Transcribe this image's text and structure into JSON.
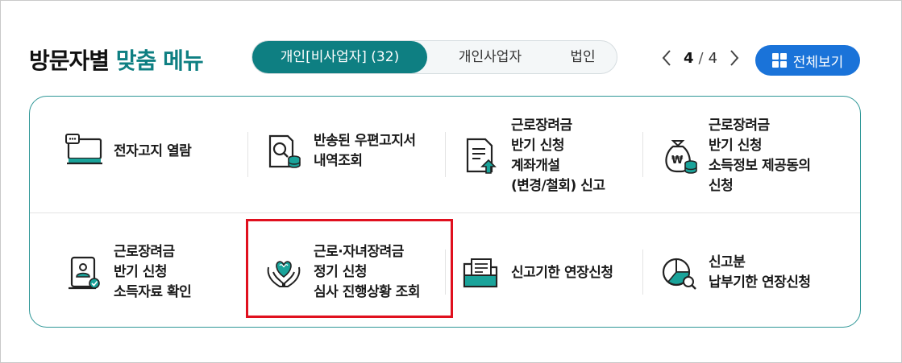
{
  "header": {
    "title_main": "방문자별",
    "title_accent": "맞춤 메뉴",
    "tabs": [
      {
        "label": "개인[비사업자] (32)",
        "active": true
      },
      {
        "label": "개인사업자",
        "active": false
      },
      {
        "label": "법인",
        "active": false
      }
    ],
    "pager": {
      "current": "4",
      "separator": "/",
      "total": "4"
    },
    "view_all_label": "전체보기"
  },
  "menu": {
    "items": [
      {
        "label": "전자고지 열람",
        "icon": "monitor-message-icon"
      },
      {
        "label": "반송된 우편고지서\n내역조회",
        "icon": "document-search-coins-icon"
      },
      {
        "label": "근로장려금\n반기 신청\n계좌개설\n(변경/철회) 신고",
        "icon": "document-upload-icon"
      },
      {
        "label": "근로장려금\n반기 신청\n소득정보 제공동의\n신청",
        "icon": "money-bag-coins-icon"
      },
      {
        "label": "근로장려금\n반기 신청\n소득자료 확인",
        "icon": "certificate-scroll-icon"
      },
      {
        "label": "근로·자녀장려금\n정기 신청\n심사 진행상황 조회",
        "icon": "hands-heart-icon"
      },
      {
        "label": "신고기한 연장신청",
        "icon": "folder-document-icon"
      },
      {
        "label": "신고분\n납부기한 연장신청",
        "icon": "pie-chart-search-icon"
      }
    ]
  },
  "colors": {
    "accent_teal": "#0e7f82",
    "button_blue": "#1a73d9",
    "highlight_red": "#e0101e"
  }
}
